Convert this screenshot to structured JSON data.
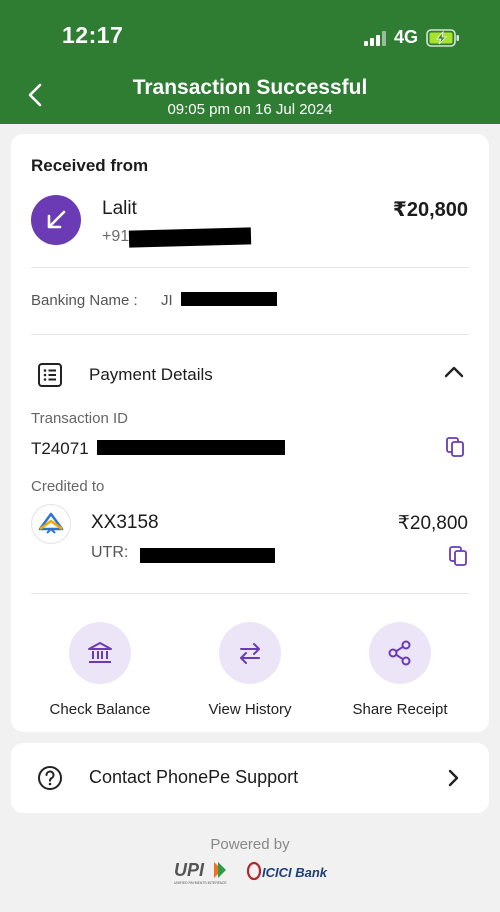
{
  "status_bar": {
    "time": "12:17",
    "network": "4G"
  },
  "header": {
    "title": "Transaction Successful",
    "subtitle": "09:05 pm on 16 Jul 2024"
  },
  "sender": {
    "section_label": "Received from",
    "name": "Lalit",
    "phone_visible": "+91",
    "amount": "₹20,800",
    "banking_name_label": "Banking Name  :",
    "banking_name_value": "JI"
  },
  "payment_details": {
    "title": "Payment Details",
    "transaction_id_label": "Transaction ID",
    "transaction_id_visible": "T24071",
    "credited_to_label": "Credited to",
    "account": "XX3158",
    "account_amount": "₹20,800",
    "utr_label": "UTR:"
  },
  "actions": [
    {
      "label": "Check Balance",
      "icon": "bank-icon"
    },
    {
      "label": "View History",
      "icon": "swap-arrows-icon"
    },
    {
      "label": "Share Receipt",
      "icon": "share-icon"
    }
  ],
  "support": {
    "label": "Contact PhonePe Support"
  },
  "footer": {
    "powered_by": "Powered by",
    "upi_logo": "UPI",
    "upi_tagline": "UNIFIED PAYMENTS INTERFACE",
    "bank_logo": "ICICI Bank"
  },
  "colors": {
    "header_green": "#2e7d32",
    "accent_purple": "#6a3bb5",
    "action_bg": "#ece5f8"
  }
}
